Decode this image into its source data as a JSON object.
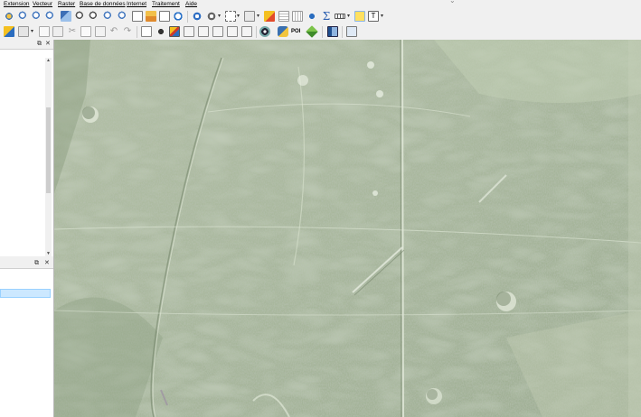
{
  "menu": {
    "items": [
      "Extension",
      "Vecteur",
      "Raster",
      "Base de données",
      "Internet",
      "Traitement",
      "Aide"
    ]
  },
  "toolbar_row1": {
    "icons": [
      "pan-icon",
      "pan-to-selection-icon",
      "zoom-in-icon",
      "zoom-out-icon",
      "zoom-full-icon",
      "zoom-selection-icon",
      "zoom-layer-icon",
      "zoom-native-icon",
      "zoom-last-icon",
      "zoom-next-icon",
      "new-bookmark-icon",
      "show-bookmarks-icon",
      "refresh-icon",
      "identify-icon",
      "select-features-icon",
      "select-by-value-icon",
      "deselect-icon",
      "attribute-table-icon",
      "field-calculator-icon",
      "statistics-icon",
      "measure-icon",
      "map-tips-icon",
      "text-annotation-icon"
    ]
  },
  "toolbar_row2": {
    "icons": [
      "digitize-edit-icon",
      "save-edits-icon",
      "add-feature-icon",
      "vertex-tool-icon",
      "delete-selected-icon",
      "cut-features-icon",
      "copy-features-icon",
      "paste-features-icon",
      "undo-icon",
      "redo-icon",
      "label-tool-icon",
      "pin-labels-icon",
      "show-hide-labels-icon",
      "move-label-icon",
      "rotate-label-icon",
      "change-label-icon",
      "georeferencer-icon",
      "python-console-icon",
      "poi-icon",
      "layer-plugin-icon",
      "help-book-icon",
      "gps-icon"
    ],
    "poi_label": "POI"
  },
  "colors": {
    "chrome": "#f0f0f0",
    "selection": "#cce8ff",
    "map_base": "#a9b89d"
  }
}
